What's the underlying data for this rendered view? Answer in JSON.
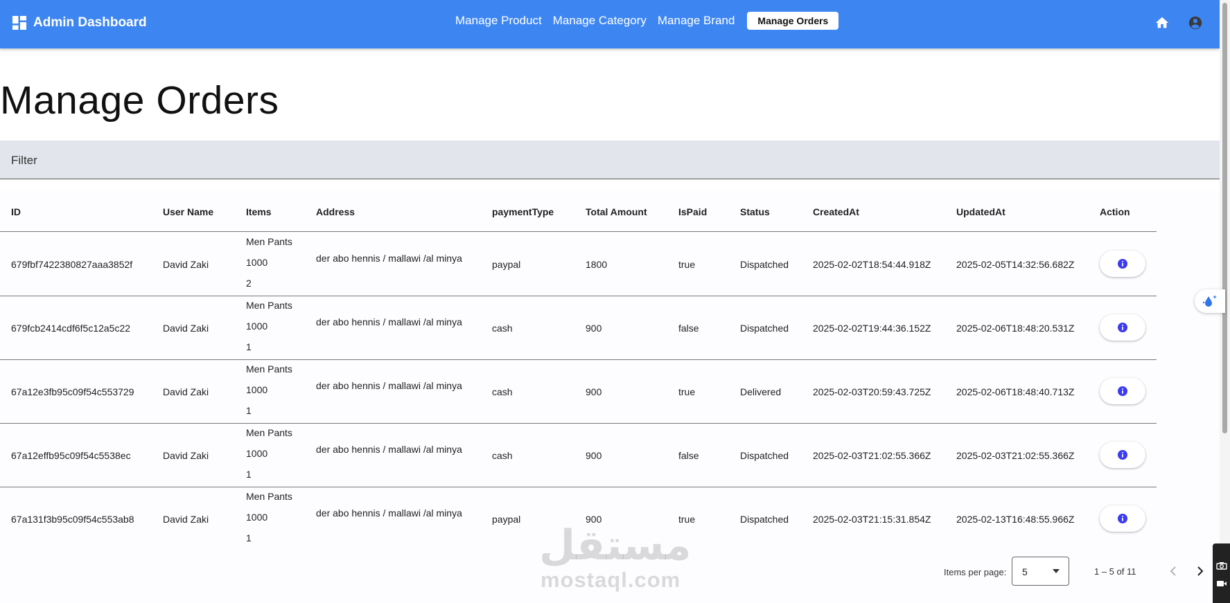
{
  "app": {
    "title": "Admin Dashboard"
  },
  "nav": {
    "items": [
      "Manage Product",
      "Manage Category",
      "Manage Brand"
    ],
    "active": "Manage Orders"
  },
  "icons": {
    "brand": "dashboard-icon",
    "home": "home-icon",
    "account": "account-circle-icon",
    "action": "info-icon"
  },
  "colors": {
    "primary": "#3d86f2",
    "filter_bg": "#e3e5ec",
    "info_icon": "#3b3bf0"
  },
  "page": {
    "title": "Manage Orders"
  },
  "filter": {
    "label": "Filter"
  },
  "table": {
    "headers": {
      "id": "ID",
      "user_name": "User Name",
      "items": "Items",
      "address": "Address",
      "payment_type": "paymentType",
      "total_amount": "Total Amount",
      "is_paid": "IsPaid",
      "status": "Status",
      "created_at": "CreatedAt",
      "updated_at": "UpdatedAt",
      "action": "Action"
    },
    "rows": [
      {
        "id": "679fbf7422380827aaa3852f",
        "user_name": "David Zaki",
        "item_name": "Men Pants",
        "item_price": "1000",
        "item_qty": "2",
        "address": "der abo hennis / mallawi /al minya",
        "payment_type": "paypal",
        "total_amount": "1800",
        "is_paid": "true",
        "status": "Dispatched",
        "created_at": "2025-02-02T18:54:44.918Z",
        "updated_at": "2025-02-05T14:32:56.682Z"
      },
      {
        "id": "679fcb2414cdf6f5c12a5c22",
        "user_name": "David Zaki",
        "item_name": "Men Pants",
        "item_price": "1000",
        "item_qty": "1",
        "address": "der abo hennis / mallawi /al minya",
        "payment_type": "cash",
        "total_amount": "900",
        "is_paid": "false",
        "status": "Dispatched",
        "created_at": "2025-02-02T19:44:36.152Z",
        "updated_at": "2025-02-06T18:48:20.531Z"
      },
      {
        "id": "67a12e3fb95c09f54c553729",
        "user_name": "David Zaki",
        "item_name": "Men Pants",
        "item_price": "1000",
        "item_qty": "1",
        "address": "der abo hennis / mallawi /al minya",
        "payment_type": "cash",
        "total_amount": "900",
        "is_paid": "true",
        "status": "Delivered",
        "created_at": "2025-02-03T20:59:43.725Z",
        "updated_at": "2025-02-06T18:48:40.713Z"
      },
      {
        "id": "67a12effb95c09f54c5538ec",
        "user_name": "David Zaki",
        "item_name": "Men Pants",
        "item_price": "1000",
        "item_qty": "1",
        "address": "der abo hennis / mallawi /al minya",
        "payment_type": "cash",
        "total_amount": "900",
        "is_paid": "false",
        "status": "Dispatched",
        "created_at": "2025-02-03T21:02:55.366Z",
        "updated_at": "2025-02-03T21:02:55.366Z"
      },
      {
        "id": "67a131f3b95c09f54c553ab8",
        "user_name": "David Zaki",
        "item_name": "Men Pants",
        "item_price": "1000",
        "item_qty": "1",
        "address": "der abo hennis / mallawi /al minya",
        "payment_type": "paypal",
        "total_amount": "900",
        "is_paid": "true",
        "status": "Dispatched",
        "created_at": "2025-02-03T21:15:31.854Z",
        "updated_at": "2025-02-13T16:48:55.966Z"
      }
    ]
  },
  "paginator": {
    "items_per_page_label": "Items per page:",
    "page_size": "5",
    "range": "1 – 5 of 11"
  },
  "watermark": {
    "arabic": "مستقل",
    "latin": "mostaql.com"
  }
}
